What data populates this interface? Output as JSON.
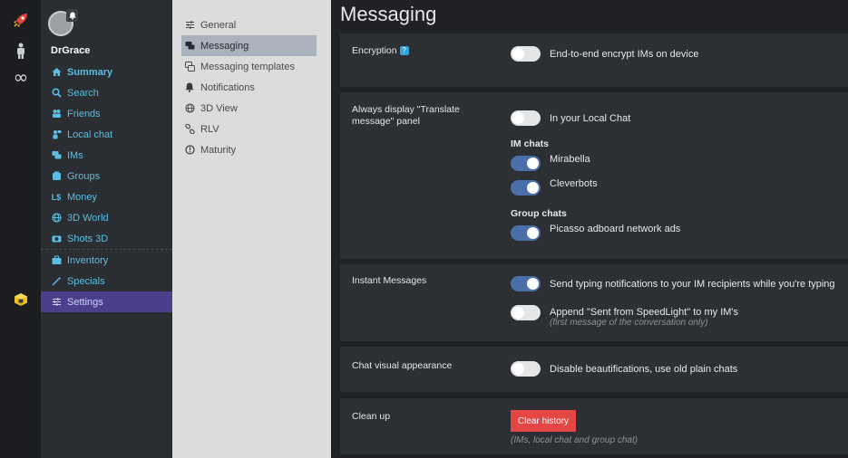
{
  "rail": {
    "icons": [
      "rocket-icon",
      "person-icon",
      "infinity-icon",
      "cube-icon"
    ]
  },
  "user": {
    "name": "DrGrace"
  },
  "nav": {
    "items": [
      {
        "label": "Summary",
        "icon": "home-icon"
      },
      {
        "label": "Search",
        "icon": "search-icon"
      },
      {
        "label": "Friends",
        "icon": "friends-icon"
      },
      {
        "label": "Local chat",
        "icon": "local-chat-icon"
      },
      {
        "label": "IMs",
        "icon": "chat-bubbles-icon"
      },
      {
        "label": "Groups",
        "icon": "groups-icon"
      },
      {
        "label": "Money",
        "icon": "money-icon",
        "glyph": "L$"
      },
      {
        "label": "3D World",
        "icon": "globe-icon"
      },
      {
        "label": "Shots 3D",
        "icon": "camera-icon"
      },
      {
        "label": "Inventory",
        "icon": "briefcase-icon"
      },
      {
        "label": "Specials",
        "icon": "wand-icon"
      },
      {
        "label": "Settings",
        "icon": "sliders-icon"
      }
    ]
  },
  "categories": {
    "items": [
      {
        "label": "General",
        "icon": "sliders-icon"
      },
      {
        "label": "Messaging",
        "icon": "chat-bubbles-icon"
      },
      {
        "label": "Messaging templates",
        "icon": "templates-icon"
      },
      {
        "label": "Notifications",
        "icon": "bell-icon"
      },
      {
        "label": "3D View",
        "icon": "globe-icon"
      },
      {
        "label": "RLV",
        "icon": "link-icon"
      },
      {
        "label": "Maturity",
        "icon": "alert-icon"
      }
    ]
  },
  "page": {
    "title": "Messaging"
  },
  "encryption": {
    "label": "Encryption",
    "help": "?",
    "option": "End-to-end encrypt IMs on device",
    "option_on": false
  },
  "translate": {
    "label": "Always display \"Translate message\" panel",
    "local_chat": "In your Local Chat",
    "local_chat_on": false,
    "im_heading": "IM chats",
    "im_chats": [
      {
        "name": "Mirabella",
        "on": true
      },
      {
        "name": "Cleverbots",
        "on": true
      }
    ],
    "group_heading": "Group chats",
    "group_chats": [
      {
        "name": "Picasso adboard network ads",
        "on": true
      }
    ]
  },
  "instant_messages": {
    "label": "Instant Messages",
    "typing": "Send typing notifications to your IM recipients while you're typing",
    "typing_on": true,
    "append": "Append \"Sent from SpeedLight\" to my IM's",
    "append_note": "(first message of the conversation only)",
    "append_on": false
  },
  "appearance": {
    "label": "Chat visual appearance",
    "option": "Disable beautifications, use old plain chats",
    "option_on": false
  },
  "cleanup": {
    "label": "Clean up",
    "button": "Clear history",
    "note": "(IMs, local chat and group chat)"
  },
  "colors": {
    "accent_link": "#5dbde0",
    "selected_nav": "#4b3f8c",
    "toggle_on": "#4a6fa8",
    "danger": "#e54545"
  }
}
